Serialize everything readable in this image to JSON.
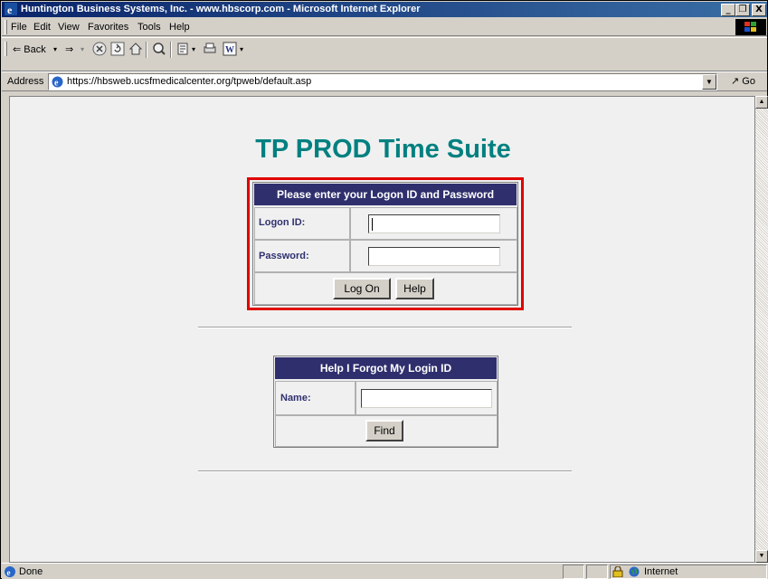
{
  "window": {
    "title": "Huntington Business Systems, Inc. - www.hbscorp.com - Microsoft Internet Explorer",
    "minimize": "_",
    "maximize": "❐",
    "close": "X"
  },
  "menu": [
    "File",
    "Edit",
    "View",
    "Favorites",
    "Tools",
    "Help"
  ],
  "toolbar": {
    "back_label": "⇐ Back",
    "forward_label": "⇒"
  },
  "address": {
    "label": "Address",
    "url": "https://hbsweb.ucsfmedicalcenter.org/tpweb/default.asp",
    "go_label": "Go"
  },
  "page": {
    "title": "TP PROD Time Suite",
    "logon_form": {
      "header": "Please enter your Logon ID and Password",
      "logon_id_label": "Logon ID:",
      "logon_id_value": "",
      "password_label": "Password:",
      "password_value": "",
      "logon_button": "Log On",
      "help_button": "Help"
    },
    "forgot_form": {
      "header": "Help I Forgot My Login ID",
      "name_label": "Name:",
      "name_value": "",
      "find_button": "Find"
    }
  },
  "status": {
    "text": "Done",
    "zone": "Internet"
  },
  "colors": {
    "title_text": "#008080",
    "form_header": "#2f2f6e",
    "highlight_box": "#e00000"
  }
}
